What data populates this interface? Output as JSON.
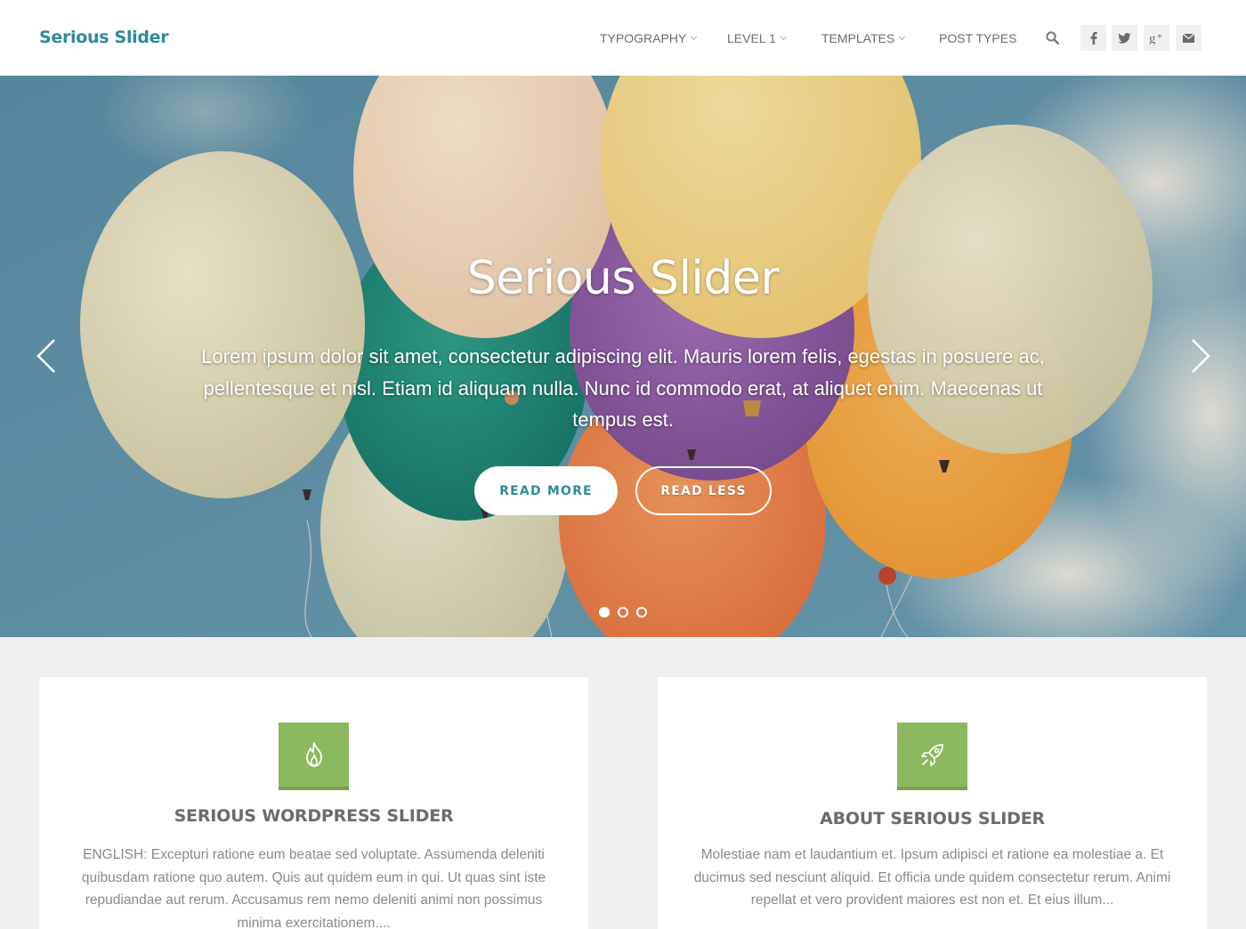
{
  "site": {
    "logo": "Serious Slider"
  },
  "nav": {
    "items": [
      {
        "label": "TYPOGRAPHY",
        "has_dropdown": true
      },
      {
        "label": "LEVEL 1",
        "has_dropdown": true
      },
      {
        "label": "TEMPLATES",
        "has_dropdown": true
      },
      {
        "label": "POST TYPES",
        "has_dropdown": false
      }
    ],
    "search_icon": "search-icon",
    "social": [
      "facebook-icon",
      "twitter-icon",
      "google-plus-icon",
      "email-icon"
    ]
  },
  "slider": {
    "title": "Serious Slider",
    "text": "Lorem ipsum dolor sit amet, consectetur adipiscing elit. Mauris lorem felis, egestas in posuere ac, pellentesque et nisl. Etiam id aliquam nulla. Nunc id commodo erat, at aliquet enim. Maecenas ut tempus est.",
    "primary_button": "READ MORE",
    "secondary_button": "READ LESS",
    "slide_count": 3,
    "active_slide": 1
  },
  "features": [
    {
      "icon": "flame-icon",
      "title": "SERIOUS WORDPRESS SLIDER",
      "text": "ENGLISH: Excepturi ratione eum beatae sed voluptate. Assumenda deleniti quibusdam ratione quo autem. Quis aut quidem eum in qui. Ut quas sint iste repudiandae aut rerum. Accusamus rem nemo deleniti animi non possimus minima exercitationem...."
    },
    {
      "icon": "rocket-icon",
      "title": "ABOUT SERIOUS SLIDER",
      "text": "Molestiae nam et laudantium et. Ipsum adipisci et ratione ea molestiae a. Et ducimus sed nesciunt aliquid. Et officia unde quidem consectetur rerum. Animi repellat et vero provident maiores est non et. Et eius illum..."
    }
  ],
  "colors": {
    "brand": "#2e8b9a",
    "icon_bg": "#8cb960",
    "page_bg": "#eef0f2",
    "text_muted": "#8a8a8a"
  }
}
